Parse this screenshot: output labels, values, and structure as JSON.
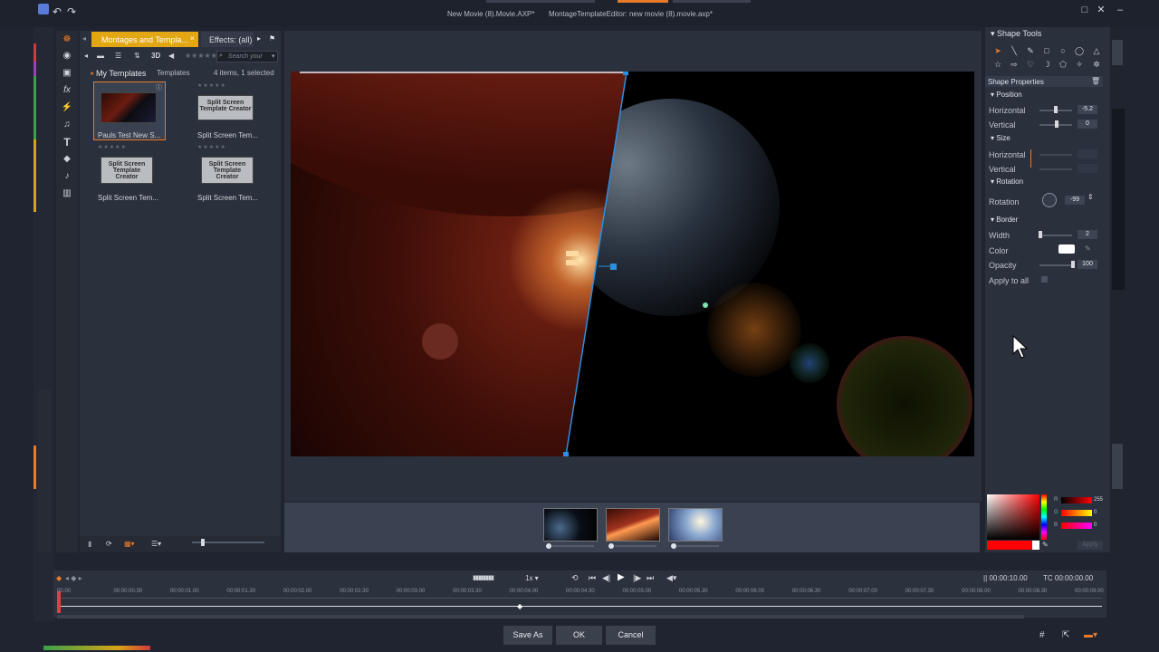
{
  "window": {
    "title_left": "New Movie (8).Movie.AXP*",
    "title_right": "MontageTemplateEditor: new movie (8).movie.axp*"
  },
  "library": {
    "tab_active": "Montages and Templa...",
    "tab_second": "Effects: (all)",
    "tool_3d": "3D",
    "search_placeholder": "Search your",
    "crumb_my": "My Templates",
    "crumb_templates": "Templates",
    "count": "4 items, 1 selected",
    "items": [
      {
        "label": "Pauls Test New S...",
        "thumb": "space-thumb",
        "selected": true
      },
      {
        "label": "Split Screen Tem...",
        "thumb_text": "Split Screen Template Creator"
      },
      {
        "label": "Split Screen Tem...",
        "thumb_text": "Split Screen Template Creator"
      },
      {
        "label": "Split Screen Tem...",
        "thumb_text": "Split Screen Template Creator"
      }
    ]
  },
  "shape_tools": {
    "title": "Shape Tools",
    "properties_title": "Shape Properties",
    "position": {
      "title": "Position",
      "horizontal_label": "Horizontal",
      "horizontal_value": "-5.2",
      "vertical_label": "Vertical",
      "vertical_value": "0"
    },
    "size": {
      "title": "Size",
      "horizontal_label": "Horizontal",
      "vertical_label": "Vertical"
    },
    "rotation": {
      "title": "Rotation",
      "label": "Rotation",
      "value": "-99"
    },
    "border": {
      "title": "Border",
      "width_label": "Width",
      "width_value": "2",
      "color_label": "Color",
      "opacity_label": "Opacity",
      "opacity_value": "100",
      "apply_label": "Apply to all"
    },
    "color_picker": {
      "r_label": "R",
      "r_value": "255",
      "g_label": "G",
      "g_value": "0",
      "b_label": "B",
      "b_value": "0",
      "apply": "Apply"
    }
  },
  "timeline": {
    "speed": "1x",
    "duration": "00:00:10.00",
    "tc_label": "TC",
    "tc_value": "00:00:00.00",
    "ticks": [
      "00.00",
      "00:00:00.30",
      "00:00:01.00",
      "00:00:01.30",
      "00:00:02.00",
      "00:00:02.30",
      "00:00:03.00",
      "00:00:03.30",
      "00:00:04.00",
      "00:00:04.30",
      "00:00:05.00",
      "00:00:05.30",
      "00:00:06.00",
      "00:00:06.30",
      "00:00:07.00",
      "00:00:07.30",
      "00:00:08.00",
      "00:00:08.30",
      "00:00:09.00"
    ]
  },
  "buttons": {
    "save_as": "Save  As",
    "ok": "OK",
    "cancel": "Cancel"
  },
  "colors": {
    "accent": "#e3a713",
    "selection": "#e87a2a",
    "handle": "#2a8fe0"
  }
}
